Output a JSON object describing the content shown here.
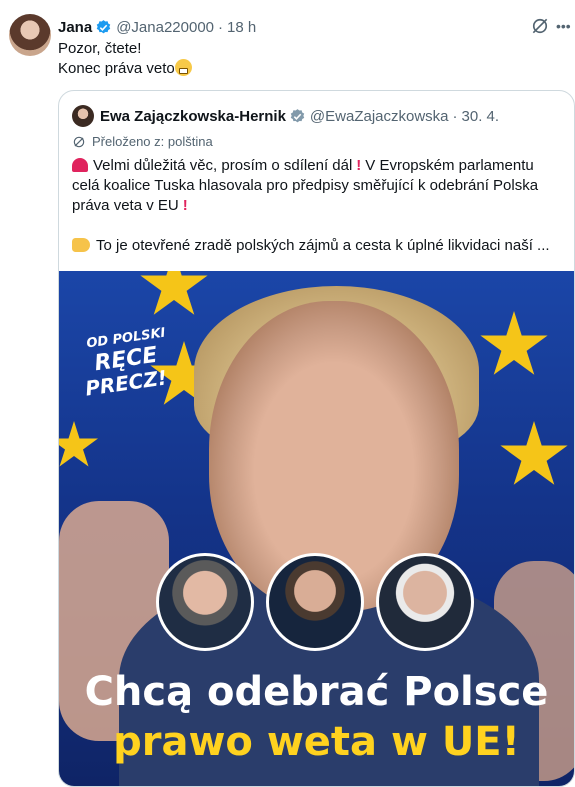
{
  "tweet": {
    "author_name": "Jana",
    "handle": "@Jana220000",
    "separator": "·",
    "time": "18 h",
    "lines": [
      "Pozor, čtete!",
      "Konec práva veto"
    ]
  },
  "quote": {
    "author_name": "Ewa Zajączkowska-Hernik",
    "handle": "@EwaZajaczkowska",
    "separator": "·",
    "date": "30. 4.",
    "translated_label": "Přeloženo z: polština",
    "lines": [
      "Velmi důležitá věc, prosím o sdílení dál",
      "V Evropském parlamentu",
      "celá koalice Tuska hlasovala pro předpisy směřující k odebrání Polska",
      "práva veta v EU",
      "To je otevřené zradě polských zájmů a cesta k úplné likvidaci naší ..."
    ]
  },
  "media": {
    "logo_lines": [
      "OD POLSKI",
      "RĘCE",
      "PRECZ!"
    ],
    "headline_line1": "Chcą odebrać Polsce",
    "headline_line2": "prawo weta w UE!"
  },
  "colors": {
    "verified": "#1d9bf0",
    "text_secondary": "#536471",
    "border": "#cfd9de",
    "headline_yellow": "#ffd21f"
  },
  "icons": [
    "verified-badge-icon",
    "grok-icon",
    "more-icon",
    "translate-icon",
    "siren-icon",
    "exclamation-icon",
    "pointing-hand-icon",
    "grimacing-emoji"
  ]
}
